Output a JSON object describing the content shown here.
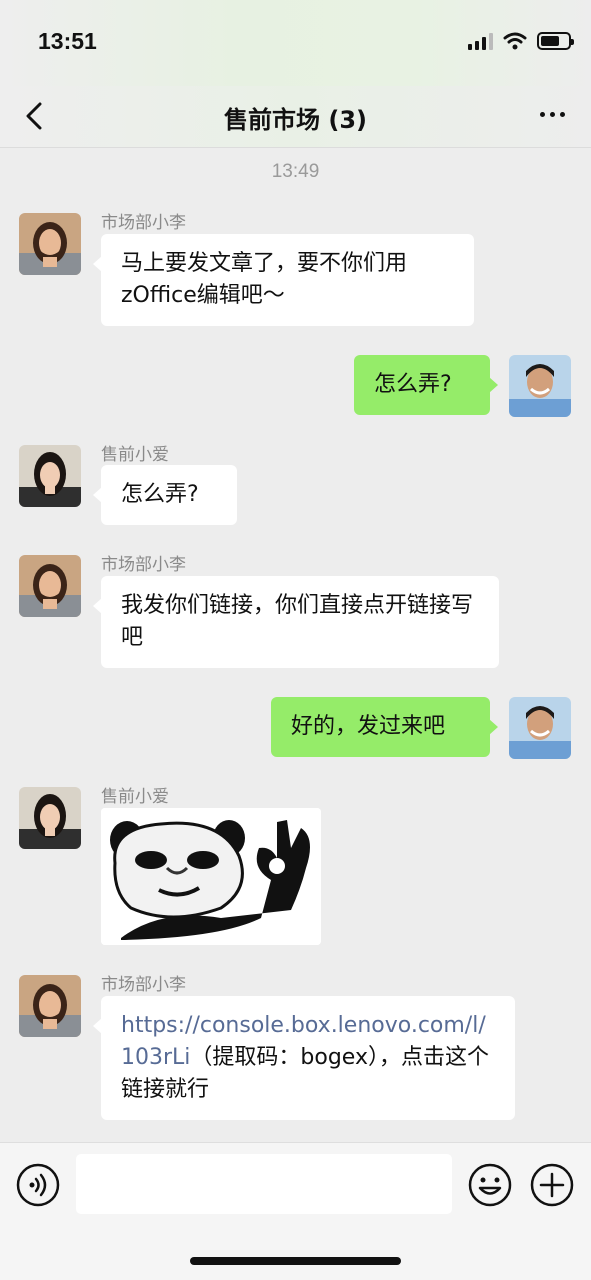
{
  "status_bar": {
    "time": "13:51"
  },
  "header": {
    "title": "售前市场 (3)"
  },
  "chat": {
    "timestamp": "13:49",
    "messages": [
      {
        "sender": "市场部小李",
        "text": "马上要发文章了，要不你们用zOffice编辑吧～"
      },
      {
        "sender": "",
        "text": "怎么弄?"
      },
      {
        "sender": "售前小爱",
        "text": "怎么弄?"
      },
      {
        "sender": "市场部小李",
        "text": "我发你们链接，你们直接点开链接写吧"
      },
      {
        "sender": "",
        "text": "好的，发过来吧"
      },
      {
        "sender": "售前小爱",
        "sticker": "panda-ok-sticker"
      },
      {
        "sender": "市场部小李",
        "link": "https://console.box.lenovo.com/l/103rLi",
        "text": "（提取码：bogex），点击这个链接就行"
      }
    ]
  },
  "input_bar": {
    "value": ""
  },
  "colors": {
    "self_bubble": "#95ec69",
    "other_bubble": "#ffffff",
    "link": "#576b95",
    "background": "#ededed"
  }
}
